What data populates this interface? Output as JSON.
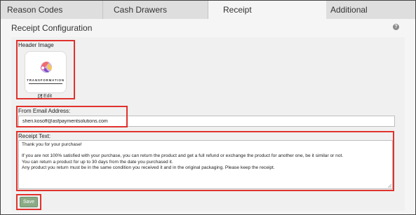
{
  "tabs": [
    {
      "label": "Reason Codes",
      "active": false
    },
    {
      "label": "Cash Drawers",
      "active": false
    },
    {
      "label": "Receipt",
      "active": true
    },
    {
      "label": "Additional",
      "active": false
    }
  ],
  "page": {
    "title": "Receipt Configuration",
    "help_icon": "question-circle-icon"
  },
  "header_image": {
    "label": "Header Image",
    "logo_text": "TRANSFORMATION",
    "edit_label": "Edit",
    "edit_icon": "edit-pencil-icon"
  },
  "email": {
    "label": "From Email Address:",
    "value": "sheri.kosoff@asfpaymentsolutions.com"
  },
  "receipt": {
    "label": "Receipt Text:",
    "value": "Thank you for your purchase!\n\nIf you are not 100% satisfied with your purchase, you can return the product and get a full refund or exchange the product for another one, be it similar or not.\nYou can return a product for up to 30 days from the date you purchased it.\nAny product you return must be in the same condition you received it and in the original packaging. Please keep the receipt."
  },
  "actions": {
    "save_label": "Save"
  },
  "colors": {
    "highlight_red": "#e0322d",
    "save_green": "#8aab86",
    "tab_inactive": "#dedede",
    "page_background": "#f5f5f5"
  }
}
